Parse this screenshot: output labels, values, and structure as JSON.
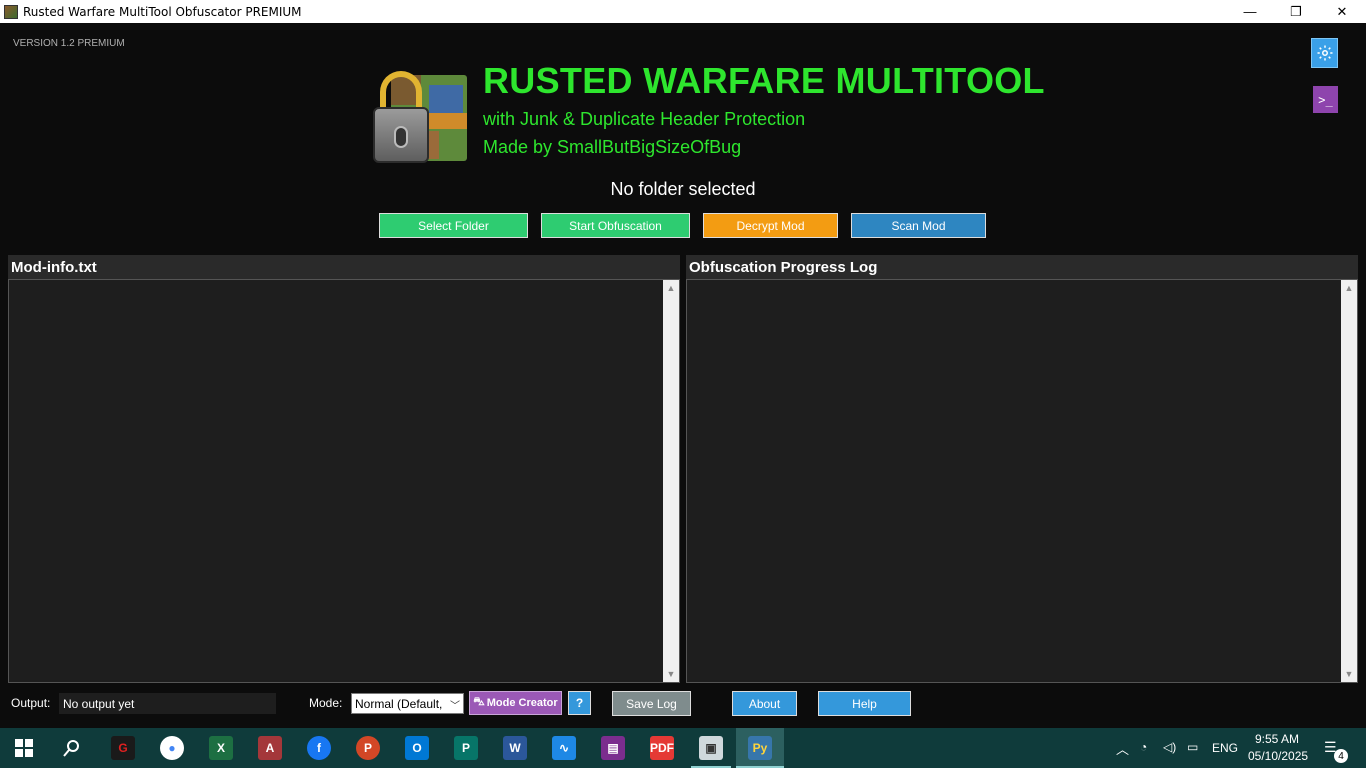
{
  "window": {
    "title": "Rusted Warfare MultiTool Obfuscator PREMIUM",
    "minimize_glyph": "—",
    "maximize_glyph": "❐",
    "close_glyph": "✕"
  },
  "header": {
    "version": "VERSION 1.2 PREMIUM",
    "title": "RUSTED WARFARE MULTITOOL",
    "subtitle": "with Junk & Duplicate Header Protection",
    "author": "Made by SmallButBigSizeOfBug",
    "folder_status": "No folder selected",
    "settings_icon": "gear-icon",
    "terminal_label": ">_"
  },
  "actions": {
    "select_folder": "Select Folder",
    "start_obfuscation": "Start Obfuscation",
    "decrypt_mod": "Decrypt Mod",
    "scan_mod": "Scan Mod"
  },
  "panels": {
    "left_title": "Mod-info.txt",
    "right_title": "Obfuscation Progress Log"
  },
  "footer": {
    "output_label": "Output:",
    "output_value": "No output yet",
    "mode_label": "Mode:",
    "mode_value": "Normal (Default,",
    "mode_creator": "Mode Creator",
    "help_q": "?",
    "save_log": "Save Log",
    "about": "About",
    "help": "Help"
  },
  "taskbar": {
    "language": "ENG",
    "time": "9:55 AM",
    "date": "05/10/2025",
    "notification_count": "4",
    "apps": [
      "start",
      "search",
      "garena",
      "chrome",
      "excel",
      "access",
      "facebook",
      "powerpoint",
      "outlook",
      "publisher",
      "word",
      "analytics",
      "winrar",
      "pdf",
      "explorer-app",
      "python"
    ]
  },
  "colors": {
    "accent_green": "#2ee62e",
    "button_green": "#2ecc71",
    "button_orange": "#f39c12",
    "button_blue": "#2e86c1",
    "button_purple": "#9b59b6",
    "panel_bg": "#1e1e1e"
  }
}
